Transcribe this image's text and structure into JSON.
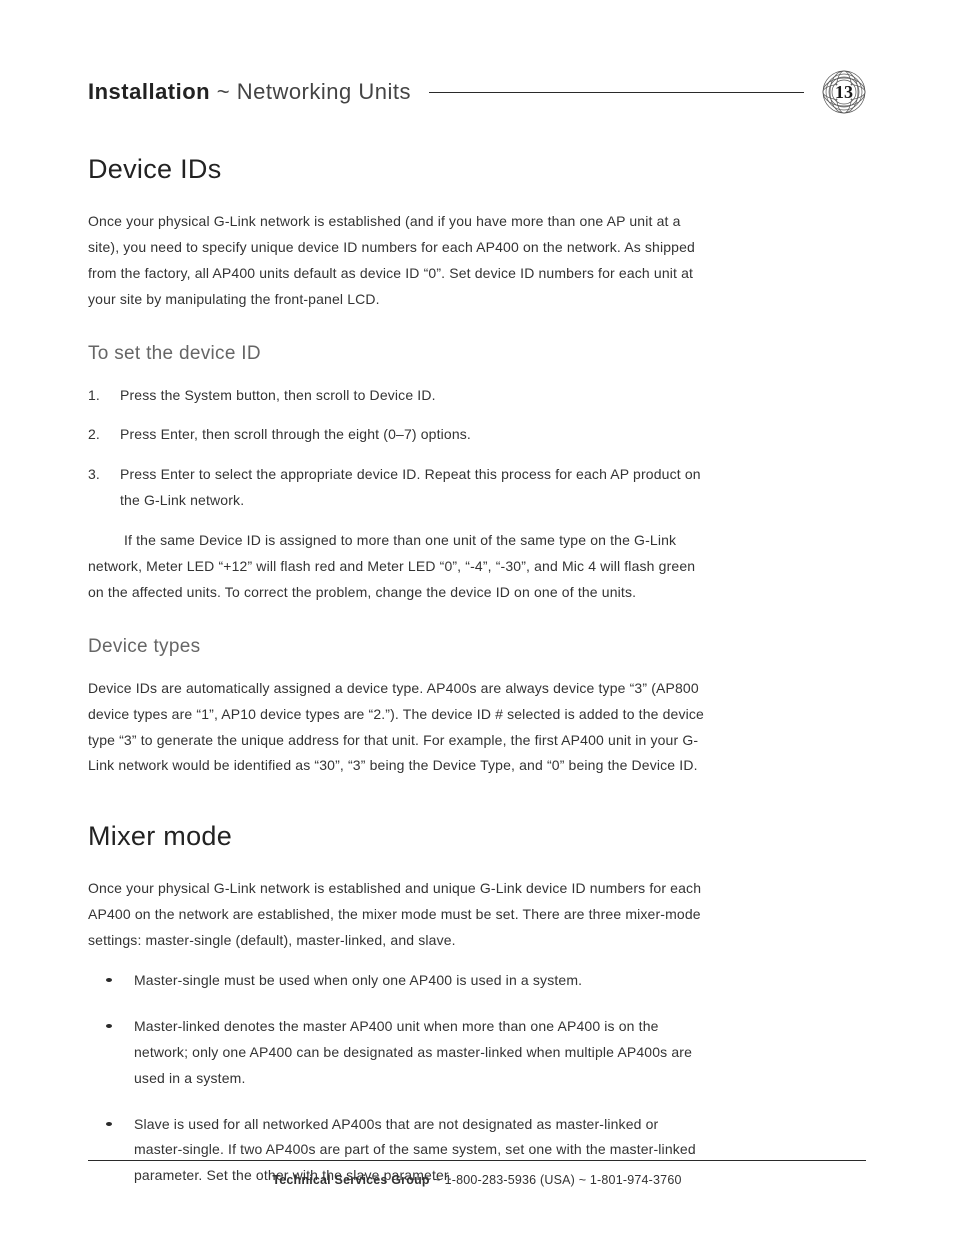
{
  "header": {
    "title_strong": "Installation",
    "title_sep": " ~ ",
    "title_rest": "Networking Units",
    "page_number": "13"
  },
  "section1": {
    "heading": "Device IDs",
    "intro": "Once your physical G-Link network is established (and if you have more than one AP unit at a site), you need to specify unique device ID numbers for each AP400 on the network. As shipped from the factory, all AP400 units default as device ID “0”. Set device ID numbers for each unit at your site by manipulating the front-panel LCD.",
    "sub1": {
      "heading": "To set the device ID",
      "steps": [
        "Press the System button, then scroll to Device ID.",
        "Press Enter, then scroll through the eight (0–7) options.",
        "Press Enter to select the appropriate device ID. Repeat this process for each AP product on the G-Link network."
      ],
      "note": "If the same Device ID is assigned to more than one unit of the same type on the G-Link network, Meter LED “+12” will flash red and Meter LED “0”, “-4”, “-30”, and Mic 4 will flash green on the affected units. To correct the problem, change the device ID on one of the units."
    },
    "sub2": {
      "heading": "Device types",
      "body": "Device IDs are automatically assigned a device type. AP400s are always device type “3” (AP800 device types are “1”, AP10 device types are “2.”). The device ID # selected is added to the device type “3” to generate the unique address for that unit. For example, the first AP400 unit in your G-Link network would be identified as “30”, “3” being the Device Type, and “0” being the Device ID."
    }
  },
  "section2": {
    "heading": "Mixer mode",
    "intro": "Once your physical G-Link network is established and unique G-Link device ID numbers for each AP400 on the network are established, the mixer mode must be set. There are three mixer-mode settings: master-single (default), master-linked, and slave.",
    "bullets": [
      "Master-single must be used when only one AP400 is used in a system.",
      "Master-linked denotes the master AP400 unit when more than one AP400 is on the network; only one AP400 can be designated as master-linked when multiple AP400s are used in a system.",
      "Slave is used for all networked AP400s that are not designated as master-linked or master-single. If two AP400s are part of the same system, set one with the master-linked parameter. Set the other with the slave parameter."
    ]
  },
  "footer": {
    "label": "Technical Services Group",
    "rest": " ~ 1-800-283-5936 (USA) ~ 1-801-974-3760"
  }
}
